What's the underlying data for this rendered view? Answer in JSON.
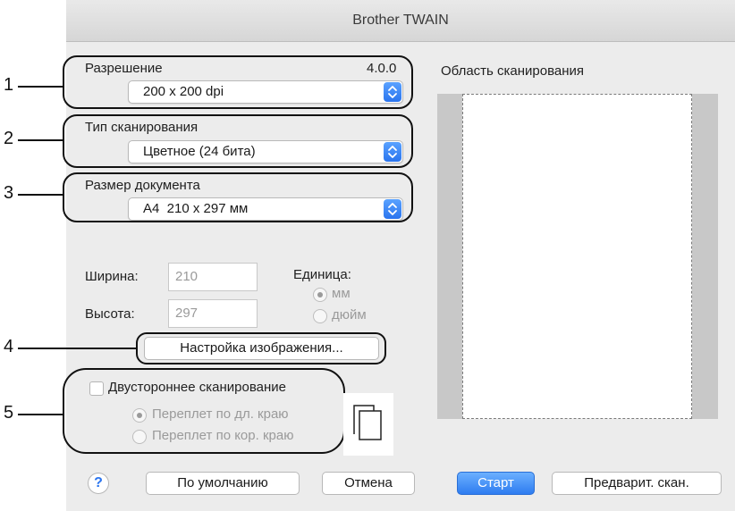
{
  "window": {
    "title": "Brother TWAIN"
  },
  "callouts": [
    "1",
    "2",
    "3",
    "4",
    "5"
  ],
  "resolution": {
    "label": "Разрешение",
    "version": "4.0.0",
    "value": "200 x 200 dpi"
  },
  "scan_type": {
    "label": "Тип сканирования",
    "value": "Цветное (24 бита)"
  },
  "document_size": {
    "label": "Размер документа",
    "value": "A4  210 x 297 мм"
  },
  "dimensions": {
    "width_label": "Ширина:",
    "width_value": "210",
    "height_label": "Высота:",
    "height_value": "297"
  },
  "unit": {
    "label": "Единица:",
    "options": [
      "мм",
      "дюйм"
    ],
    "selected": "мм"
  },
  "image_settings_button": "Настройка изображения...",
  "duplex": {
    "label": "Двустороннее сканирование",
    "checked": false,
    "options": [
      "Переплет по дл. краю",
      "Переплет по кор. краю"
    ],
    "selected": "Переплет по дл. краю"
  },
  "scan_area": {
    "label": "Область сканирования"
  },
  "footer": {
    "help": "?",
    "default_button": "По умолчанию",
    "cancel_button": "Отмена",
    "start_button": "Старт",
    "prescan_button": "Предварит. скан."
  },
  "colors": {
    "accent": "#2e7cf0",
    "window_bg": "#ececec",
    "scan_area_bg": "#c8c8c8"
  },
  "icons": {
    "popup": "updown-chevron-icon",
    "duplex": "duplex-pages-icon",
    "help": "help-icon"
  }
}
